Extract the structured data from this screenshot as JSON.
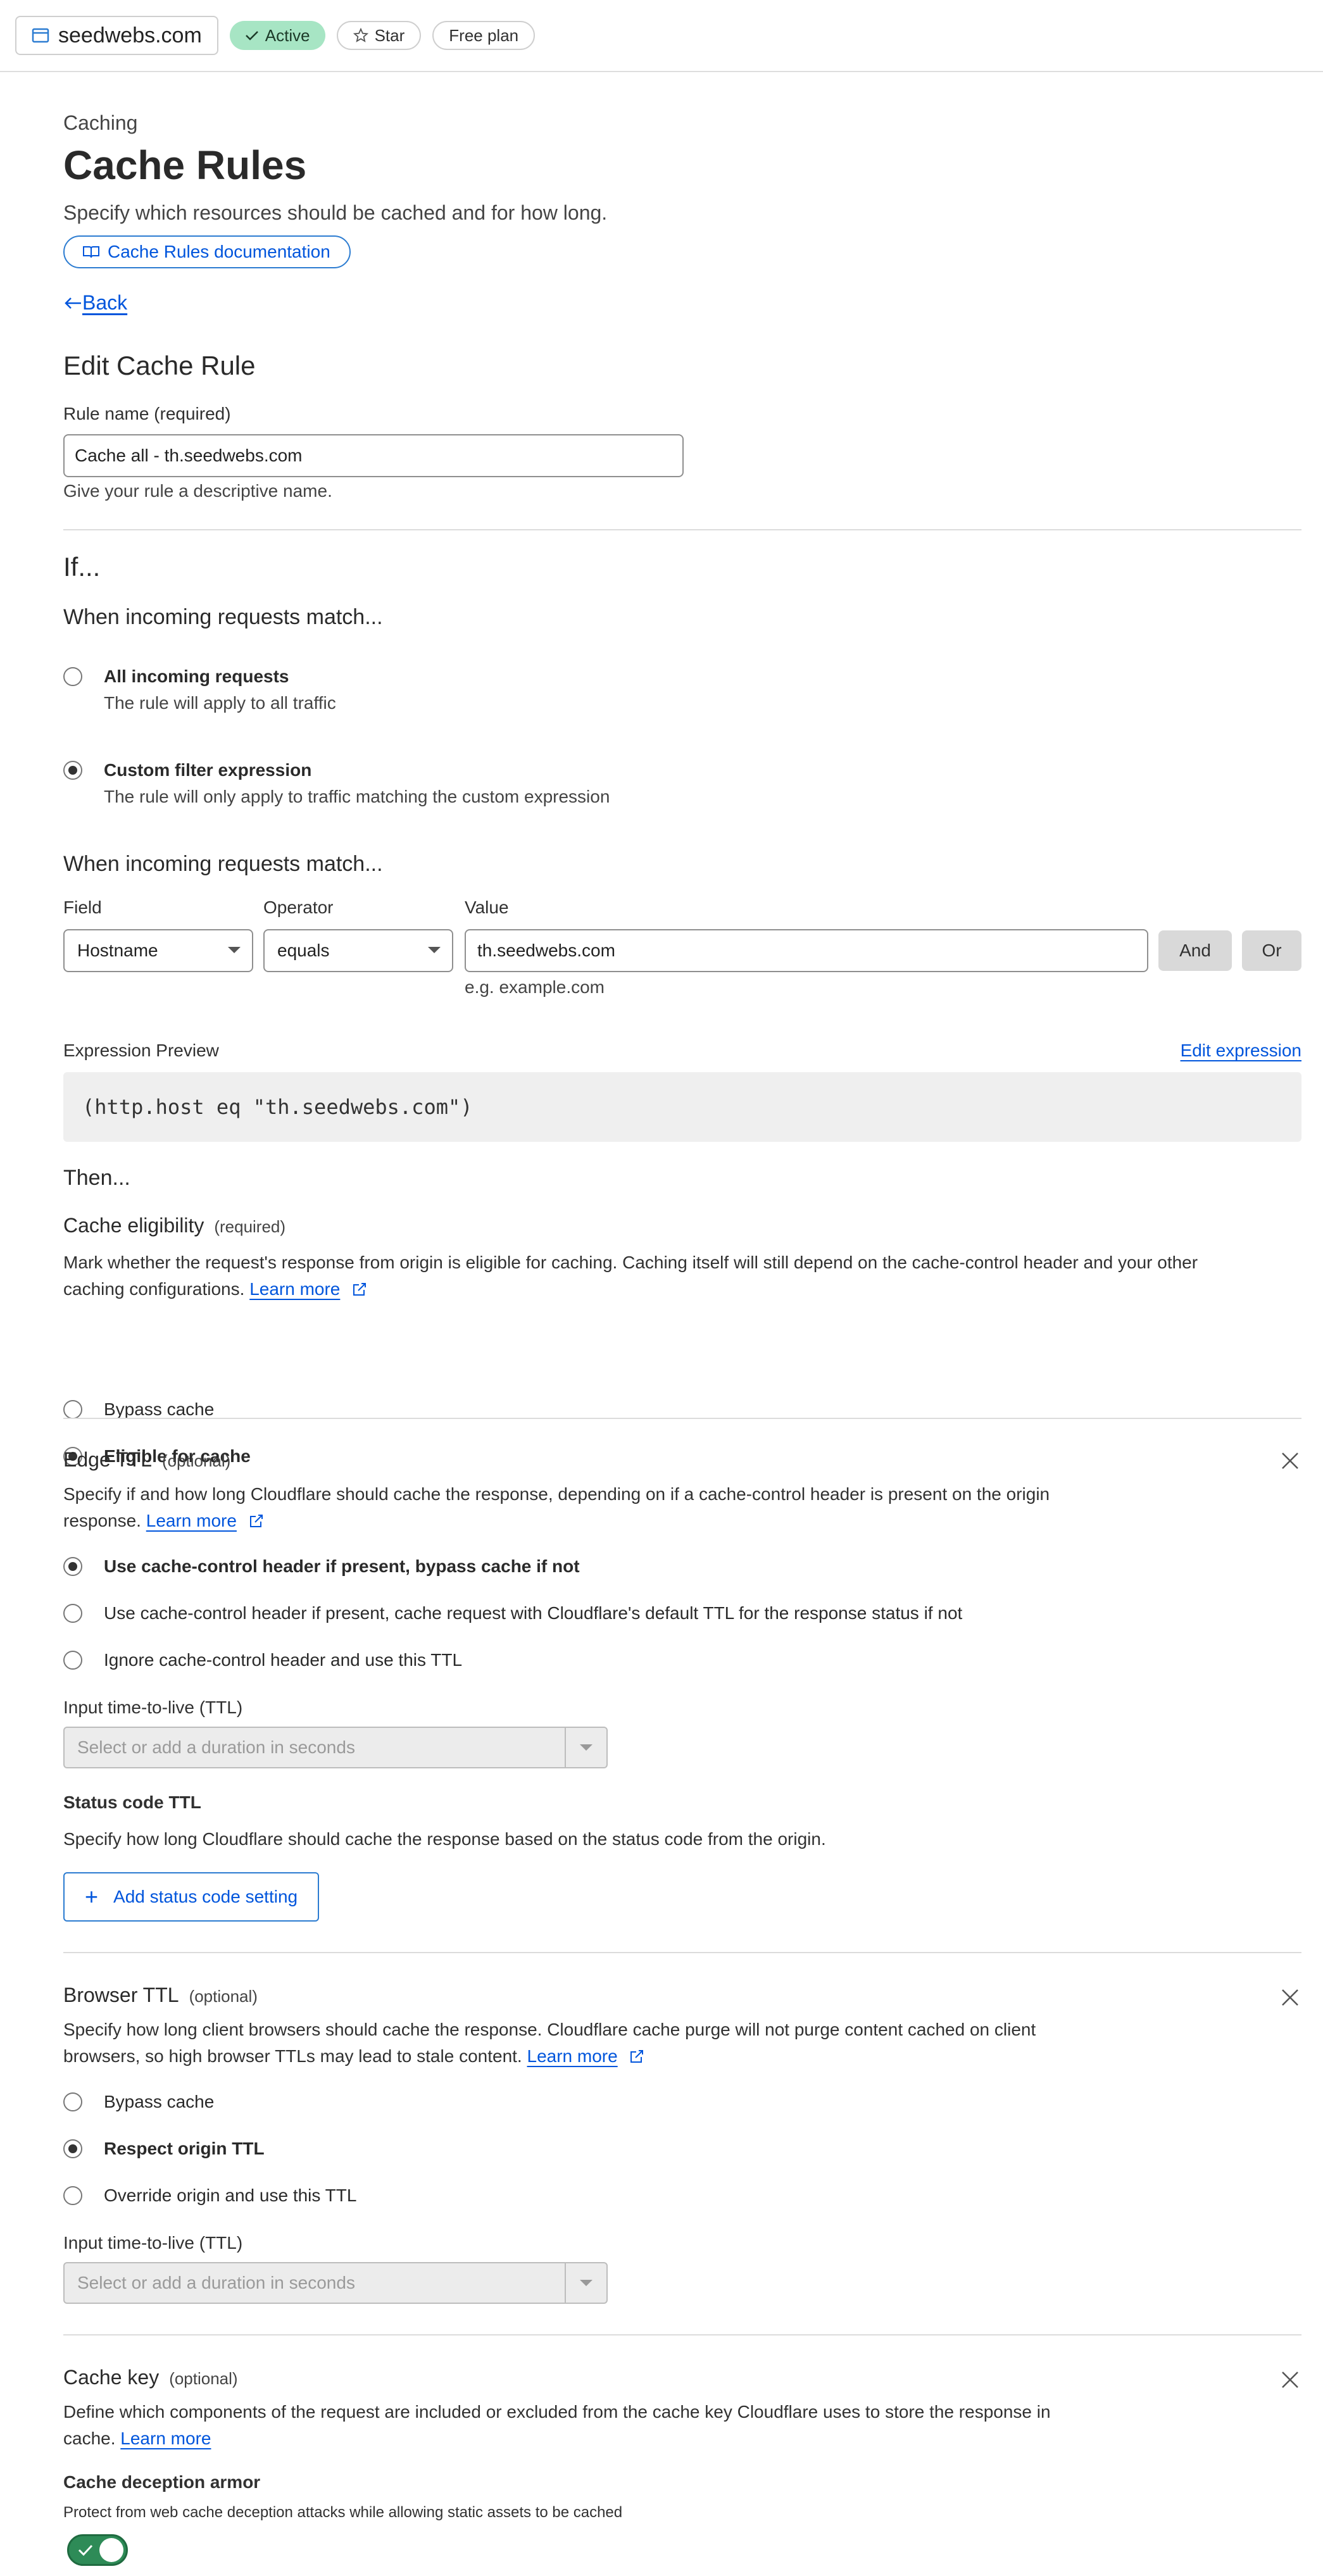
{
  "topbar": {
    "zone": "seedwebs.com",
    "status": "Active",
    "star": "Star",
    "plan": "Free plan"
  },
  "header": {
    "eyebrow": "Caching",
    "title": "Cache Rules",
    "description": "Specify which resources should be cached and for how long.",
    "doc_link": "Cache Rules documentation",
    "back": "Back"
  },
  "rule": {
    "heading": "Edit Cache Rule",
    "name_label": "Rule name (required)",
    "name_value": "Cache all - th.seedwebs.com",
    "name_hint": "Give your rule a descriptive name."
  },
  "if_section": {
    "heading": "If...",
    "match_heading": "When incoming requests match...",
    "options": [
      {
        "title": "All incoming requests",
        "subtitle": "The rule will apply to all traffic",
        "selected": false
      },
      {
        "title": "Custom filter expression",
        "subtitle": "The rule will only apply to traffic matching the custom expression",
        "selected": true
      }
    ],
    "builder_heading": "When incoming requests match...",
    "field_label": "Field",
    "operator_label": "Operator",
    "value_label": "Value",
    "field_value": "Hostname",
    "operator_value": "equals",
    "value_value": "th.seedwebs.com",
    "value_hint": "e.g. example.com",
    "and_label": "And",
    "or_label": "Or",
    "preview_label": "Expression Preview",
    "edit_expression": "Edit expression",
    "expression": "(http.host eq \"th.seedwebs.com\")"
  },
  "then_section": {
    "heading": "Then...",
    "eligibility": {
      "title": "Cache eligibility",
      "qualifier": "(required)",
      "description_line1": "Mark whether the request's response from origin is eligible for caching. Caching itself will still depend on the cache-control header and your other",
      "description_line2": "caching configurations.",
      "learn_more": "Learn more",
      "options": [
        {
          "label": "Bypass cache",
          "selected": false
        },
        {
          "label": "Eligible for cache",
          "selected": true
        }
      ]
    },
    "edge_ttl": {
      "title": "Edge TTL",
      "qualifier": "(optional)",
      "description_line1": "Specify if and how long Cloudflare should cache the response, depending on if a cache-control header is present on the origin",
      "description_line2": "response.",
      "learn_more": "Learn more",
      "options": [
        {
          "label": "Use cache-control header if present, bypass cache if not",
          "selected": true
        },
        {
          "label": "Use cache-control header if present, cache request with Cloudflare's default TTL for the response status if not",
          "selected": false
        },
        {
          "label": "Ignore cache-control header and use this TTL",
          "selected": false
        }
      ],
      "ttl_label": "Input time-to-live (TTL)",
      "ttl_placeholder": "Select or add a duration in seconds",
      "status_title": "Status code TTL",
      "status_description": "Specify how long Cloudflare should cache the response based on the status code from the origin.",
      "add_button": "Add status code setting"
    },
    "browser_ttl": {
      "title": "Browser TTL",
      "qualifier": "(optional)",
      "description_line1": "Specify how long client browsers should cache the response. Cloudflare cache purge will not purge content cached on client",
      "description_line2": "browsers, so high browser TTLs may lead to stale content.",
      "learn_more": "Learn more",
      "options": [
        {
          "label": "Bypass cache",
          "selected": false
        },
        {
          "label": "Respect origin TTL",
          "selected": true
        },
        {
          "label": "Override origin and use this TTL",
          "selected": false
        }
      ],
      "ttl_label": "Input time-to-live (TTL)",
      "ttl_placeholder": "Select or add a duration in seconds"
    },
    "cache_key": {
      "title": "Cache key",
      "qualifier": "(optional)",
      "description_line1": "Define which components of the request are included or excluded from the cache key Cloudflare uses to store the response in",
      "description_line2": "cache.",
      "learn_more": "Learn more",
      "armor_title": "Cache deception armor",
      "armor_description": "Protect from web cache deception attacks while allowing static assets to be cached",
      "armor_enabled": true
    }
  },
  "colors": {
    "link": "#0055dc",
    "active_badge": "#a7e5c4",
    "toggle_on": "#2e8b57"
  }
}
